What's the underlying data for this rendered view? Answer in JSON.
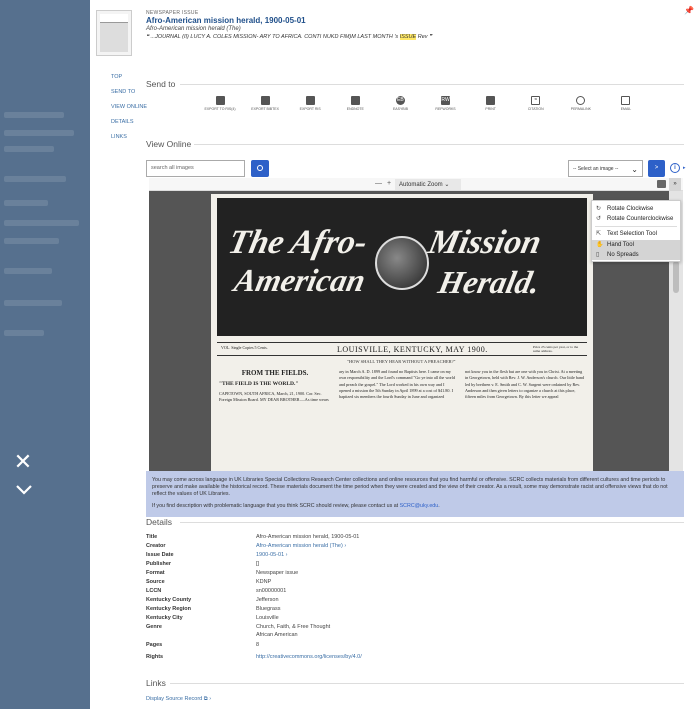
{
  "header": {
    "kicker": "NEWSPAPER ISSUE",
    "title": "Afro-American mission herald, 1900-05-01",
    "subtitle": "Afro-American mission herald (The)",
    "snippet_pre": "❝ ...JOURNAL (II) LUCY A. COLES MISSION- ARY TO AFRICA. CONTI NUKD FIM)M LAST MONTH 's ",
    "snippet_hl": "ISSUE",
    "snippet_post": " Rev ❞"
  },
  "nav": {
    "top": "TOP",
    "send_to": "SEND TO",
    "view_online": "VIEW ONLINE",
    "details": "DETAILS",
    "links": "LINKS"
  },
  "send_to": {
    "heading": "Send to",
    "items": [
      {
        "label": "EXPORT TO RIS(4)",
        "icon": "file-export-icon"
      },
      {
        "label": "EXPORT BIBTEX",
        "icon": "file-export-icon"
      },
      {
        "label": "EXPORT RIS",
        "icon": "file-export-icon"
      },
      {
        "label": "ENDNOTE",
        "icon": "file-export-icon"
      },
      {
        "label": "EASYBIB",
        "icon": "easybib-icon",
        "glyph": "EB"
      },
      {
        "label": "REFWORKS",
        "icon": "refworks-icon",
        "glyph": "RW"
      },
      {
        "label": "PRINT",
        "icon": "print-icon"
      },
      {
        "label": "CITATION",
        "icon": "quote-icon",
        "glyph": "❞"
      },
      {
        "label": "PERMALINK",
        "icon": "link-icon"
      },
      {
        "label": "EMAIL",
        "icon": "envelope-icon"
      }
    ]
  },
  "view_online": {
    "heading": "View Online",
    "search_placeholder": "search all images",
    "select_value": "-- Select an image --",
    "go_label": ">",
    "info_label": "i",
    "zoom_minus": "—",
    "zoom_plus": "+",
    "zoom_value": "Automatic Zoom",
    "more_label": "»"
  },
  "pdf_menu": {
    "rotate_cw": "Rotate Clockwise",
    "rotate_ccw": "Rotate Counterclockwise",
    "text_select": "Text Selection Tool",
    "hand_tool": "Hand Tool",
    "no_spreads": "No Spreads"
  },
  "newspaper": {
    "masthead_1": "The Afro-",
    "masthead_2": "American",
    "masthead_3": "Mission",
    "masthead_4": "Herald.",
    "vol": "VOL. Single Copies 5 Cents.",
    "place": "LOUISVILLE, KENTUCKY, MAY 1900.",
    "price": "Price 25 cents per year, or to the same address.",
    "motto": "\"HOW SHALL THEY HEAR WITHOUT A PREACHER?\"",
    "col1_head": "FROM THE FIELDS.",
    "col1_sub": "\"THE FIELD IS THE WORLD.\"",
    "col1_text": "CAPETOWN, SOUTH AFRICA, March, 21, 1900. Cor. Sec. Foreign Mission Board. MY DEAR BROTHER.—As time wears",
    "col2_text": "ary in March A. D. 1899 and found no Baptists here. I came on my own responsibility and the Lord's command \"Go ye into all the world and preach the gospel.\" The Lord worked in his own way and I opened a mission the 5th Sunday in April 1899 at a cost of $41.80. I baptized six members the fourth Sunday in June and organized",
    "col3_text": "not know you in the flesh but are one with you in Christ. At a meeting in Georgetown, held with Rev. J. W. Anderson's church. Our little band led by brethren v. E. Smith and C. W. Sargent were ordained by Rev. Anderson and then given letters to organize a church at this place, fifteen miles from Georgetown. By this letter we appeal"
  },
  "notice": {
    "p1": "You may come across language in UK Libraries Special Collections Research Center collections and online resources that you find harmful or offensive. SCRC collects materials from different cultures and time periods to preserve and make available the historical record. These materials document the time period when they were created and the view of their creator. As a result, some may demonstrate racist and offensive views that do not reflect the values of UK Libraries.",
    "p2": "If you find description with problematic language that you think SCRC should review, please contact us at",
    "email": "SCRC@uky.edu",
    "p2_end": "."
  },
  "details": {
    "heading": "Details",
    "rows": [
      {
        "k": "Title",
        "v": "Afro-American mission herald, 1900-05-01",
        "link": false
      },
      {
        "k": "Creator",
        "v": "Afro-American mission herald (The) ›",
        "link": true
      },
      {
        "k": "Issue Date",
        "v": "1900-05-01 ›",
        "link": true
      },
      {
        "k": "Publisher",
        "v": "[]",
        "link": false
      },
      {
        "k": "Format",
        "v": "Newspaper issue",
        "link": false
      },
      {
        "k": "Source",
        "v": "KDNP",
        "link": false
      },
      {
        "k": "LCCN",
        "v": "sn00000001",
        "link": false
      },
      {
        "k": "Kentucky County",
        "v": "Jefferson",
        "link": false
      },
      {
        "k": "Kentucky Region",
        "v": "Bluegrass",
        "link": false
      },
      {
        "k": "Kentucky City",
        "v": "Louisville",
        "link": false
      },
      {
        "k": "Genre",
        "v": "Church, Faith, & Free Thought",
        "link": false
      },
      {
        "k": "",
        "v": "African American",
        "link": false
      },
      {
        "k": "Pages",
        "v": "8",
        "link": false
      },
      {
        "k": "Rights",
        "v": "http://creativecommons.org/licenses/by/4.0/",
        "link": true
      }
    ]
  },
  "links": {
    "heading": "Links",
    "display_source": "Display Source Record ⧉ ›"
  }
}
